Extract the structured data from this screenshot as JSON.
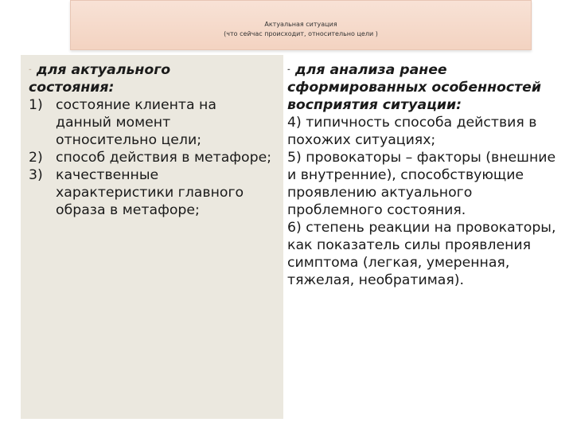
{
  "title": {
    "line1": "Актуальная ситуация",
    "line2": "(что сейчас происходит, относительно цели )"
  },
  "left": {
    "dash": "-",
    "heading_line1": " для актуального",
    "heading_line2": "состояния:",
    "items": [
      {
        "num": "1)",
        "text": "состояние клиента на данный момент относительно цели;"
      },
      {
        "num": "2)",
        "text": "способ действия в метафоре;"
      },
      {
        "num": "3)",
        "text": "качественные характеристики главного образа в метафоре;"
      }
    ]
  },
  "right": {
    "dash": "-",
    "heading": " для анализа ранее сформированных особенностей восприятия ситуации:",
    "paragraphs": [
      "4) типичность способа действия в похожих ситуациях;",
      "5) провокаторы – факторы (внешние и внутренние), способствующие проявлению актуального проблемного состояния.",
      "6) степень реакции на провокаторы, как показатель силы проявления симптома (легкая, умеренная, тяжелая, необратимая)."
    ]
  },
  "colors": {
    "title_bg": "#f5d9c9",
    "left_bg": "#ebe8df",
    "right_bg": "#ffffff"
  }
}
